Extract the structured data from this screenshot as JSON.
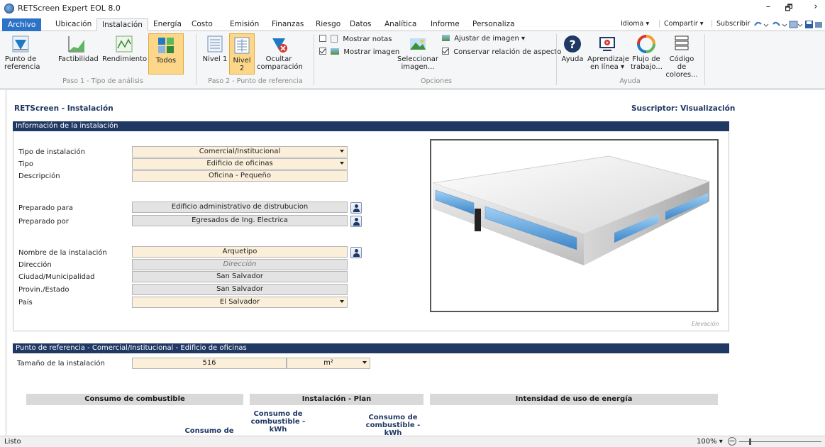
{
  "window": {
    "title": "RETScreen Expert EOL 8.0",
    "minimize": "–",
    "restore": "🗗",
    "more": "›"
  },
  "menu": {
    "tabs": [
      "Archivo",
      "Ubicación",
      "Instalación",
      "Energía",
      "Costo",
      "Emisión",
      "Finanzas",
      "Riesgo",
      "Datos",
      "Analítica",
      "Informe",
      "Personaliza"
    ],
    "active": "Instalación",
    "idioma": "Idioma ▾",
    "compartir": "Compartir ▾",
    "suscribir": "Subscribir"
  },
  "ribbon": {
    "paso1": {
      "label": "Paso 1 - Tipo de análisis",
      "buttons": [
        "Punto de referencia",
        "Factibilidad",
        "Rendimiento",
        "Todos"
      ]
    },
    "paso2": {
      "label": "Paso 2 - Punto de referencia",
      "buttons": [
        "Nivel 1",
        "Nivel 2",
        "Ocultar comparación"
      ]
    },
    "opciones": {
      "label": "Opciones",
      "mostrar_notas": "Mostrar notas",
      "mostrar_imagen": "Mostrar imagen",
      "seleccionar_imagen": "Seleccionar imagen...",
      "ajustar_imagen": "Ajustar de imagen ▾",
      "conservar": "Conservar relación de aspecto"
    },
    "ayuda": {
      "label": "Ayuda",
      "buttons": [
        "Ayuda",
        "Aprendizaje en línea ▾",
        "Flujo de trabajo...",
        "Código de colores..."
      ]
    }
  },
  "page": {
    "title": "RETScreen - Instalación",
    "subscriber": "Suscriptor: Visualización"
  },
  "facility": {
    "header": "Información de la instalación",
    "tipo_instalacion": {
      "label": "Tipo de instalación",
      "value": "Comercial/Institucional"
    },
    "tipo": {
      "label": "Tipo",
      "value": "Edificio de oficinas"
    },
    "descripcion": {
      "label": "Descripción",
      "value": "Oficina - Pequeño"
    },
    "preparado_para": {
      "label": "Preparado para",
      "value": "Edificio administrativo de distrubucion"
    },
    "preparado_por": {
      "label": "Preparado por",
      "value": "Egresados de Ing. Electrica"
    },
    "nombre": {
      "label": "Nombre de la instalación",
      "value": "Arquetipo"
    },
    "direccion": {
      "label": "Dirección",
      "value": "Dirección"
    },
    "ciudad": {
      "label": "Ciudad/Municipalidad",
      "value": "San Salvador"
    },
    "provincia": {
      "label": "Provin./Estado",
      "value": "San Salvador"
    },
    "pais": {
      "label": "País",
      "value": "El Salvador"
    },
    "image_caption": "Elevación"
  },
  "benchmark": {
    "header": "Punto de referencia - Comercial/Institucional - Edificio de oficinas",
    "size_label": "Tamaño de la instalación",
    "size_value": "516",
    "size_unit": "m²",
    "consumo_header": "Consumo de combustible",
    "plan_header": "Instalación - Plan",
    "intensidad_header": "Intensidad de uso de energía",
    "col_consumo": "Consumo de",
    "col_kwh1": "Consumo de combustible - kWh",
    "col_kwh2": "Consumo de combustible - kWh"
  },
  "status": {
    "text": "Listo",
    "zoom": "100% ▾"
  },
  "colors": {
    "accent": "#2c72c7",
    "section": "#1f3864",
    "input_tan": "#fbefd9",
    "input_gray": "#e3e3e3",
    "selected": "#fcd78a"
  }
}
